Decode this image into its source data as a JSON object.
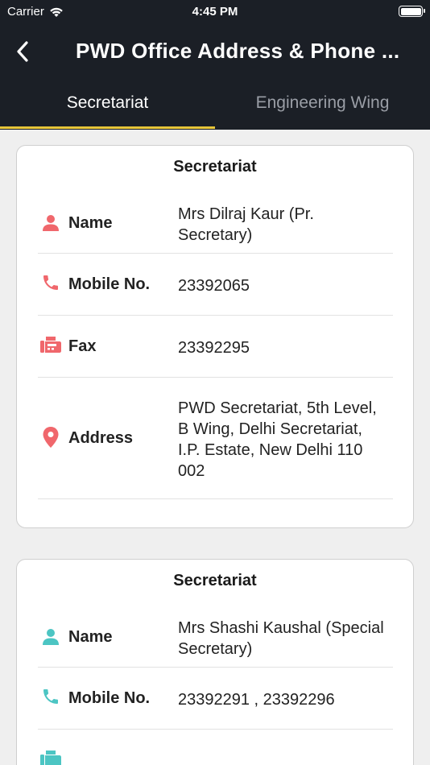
{
  "status_bar": {
    "carrier": "Carrier",
    "time": "4:45 PM"
  },
  "nav": {
    "title": "PWD Office Address & Phone ..."
  },
  "tabs": [
    {
      "label": "Secretariat",
      "active": true
    },
    {
      "label": "Engineering Wing",
      "active": false
    }
  ],
  "colors": {
    "header_bg": "#1b1f26",
    "tab_indicator": "#e8c73a",
    "icon_red": "#f0676c",
    "icon_teal": "#4cc5c3"
  },
  "cards": [
    {
      "title": "Secretariat",
      "icon_color": "#f0676c",
      "rows": [
        {
          "icon": "person-icon",
          "label": "Name",
          "value": "Mrs Dilraj Kaur   (Pr. Secretary)"
        },
        {
          "icon": "phone-icon",
          "label": "Mobile No.",
          "value": "23392065"
        },
        {
          "icon": "fax-icon",
          "label": "Fax",
          "value": "23392295"
        },
        {
          "icon": "location-pin-icon",
          "label": "Address",
          "value": "PWD Secretariat, 5th Level, B Wing, Delhi Secretariat, I.P. Estate, New Delhi 110 002"
        }
      ]
    },
    {
      "title": "Secretariat",
      "icon_color": "#4cc5c3",
      "rows": [
        {
          "icon": "person-icon",
          "label": "Name",
          "value": "Mrs Shashi Kaushal (Special Secretary)"
        },
        {
          "icon": "phone-icon",
          "label": "Mobile No.",
          "value": "23392291 , 23392296"
        }
      ]
    }
  ]
}
